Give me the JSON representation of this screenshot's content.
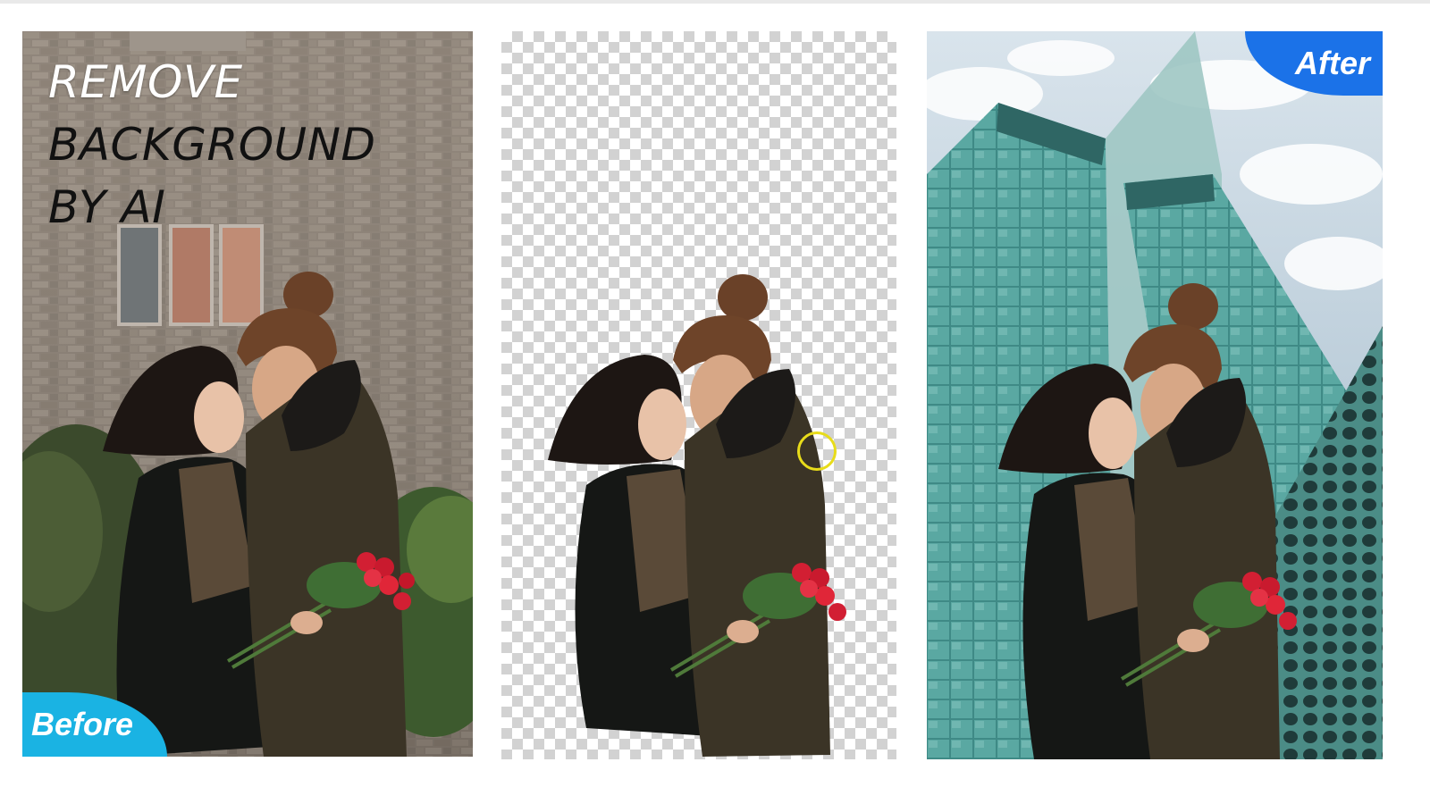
{
  "headline": {
    "line1": "REMOVE",
    "line2": "BACKGROUND",
    "line3": "BY AI"
  },
  "badges": {
    "before": "Before",
    "after": "After"
  },
  "colors": {
    "badge_before": "#1ab3e3",
    "badge_after": "#1b72e8",
    "cursor_ring": "#e8dc1a",
    "transparency_checker": "#d2d2d2"
  },
  "icons": {
    "cursor": "brush-cursor-ring-icon"
  }
}
